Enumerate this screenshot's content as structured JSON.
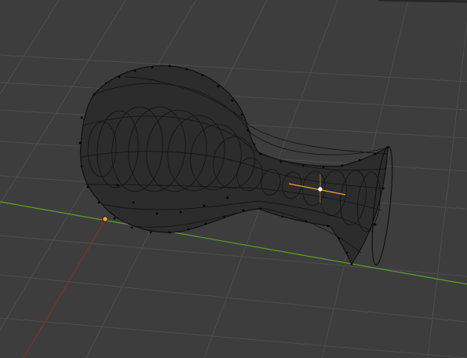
{
  "viewport": {
    "background_color": "#3d3d3d",
    "grid": {
      "visible": true,
      "line_color": "#4e4e4e",
      "x_axis_color": "#8b2b2b",
      "y_axis_color": "#5aa02c"
    },
    "header_strip": {
      "visible": true
    },
    "mesh": {
      "name": "vase",
      "display": "wireframe",
      "body_color": "#2c2c2c",
      "edge_color": "#111111",
      "vertex_color": "#000000",
      "selected": false
    },
    "object_origin": {
      "color": "#f0a030",
      "icon": "origin-dot-icon"
    },
    "cursor_3d": {
      "color": "#f5a02a",
      "icon": "crosshair-icon"
    }
  }
}
